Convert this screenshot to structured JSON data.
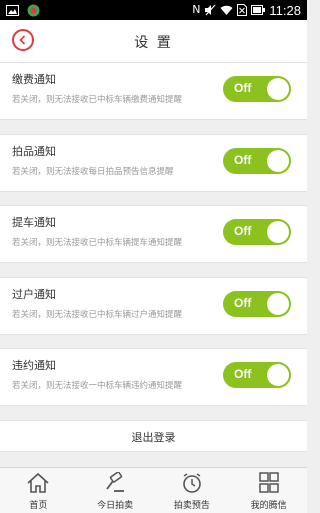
{
  "status_bar": {
    "time": "11:28",
    "icons": [
      "image-icon",
      "app-icon",
      "nfc-icon",
      "mute-icon",
      "wifi-icon",
      "no-sim-icon",
      "battery-icon"
    ]
  },
  "header": {
    "title": "设 置",
    "back_icon": "chevron-left-icon",
    "accent_color": "#e23a3a"
  },
  "settings": [
    {
      "title": "缴费通知",
      "description": "若关闭，则无法接收已中标车辆缴费通知提醒",
      "toggle": "Off"
    },
    {
      "title": "拍品通知",
      "description": "若关闭，则无法接收每日拍品预告信息提醒",
      "toggle": "Off"
    },
    {
      "title": "提车通知",
      "description": "若关闭，则无法接收已中标车辆提车通知提醒",
      "toggle": "Off"
    },
    {
      "title": "过户通知",
      "description": "若关闭，则无法接收已中标车辆过户通知提醒",
      "toggle": "Off"
    },
    {
      "title": "违约通知",
      "description": "若关闭，则无法接收一中标车辆违约通知提醒",
      "toggle": "Off"
    }
  ],
  "toggle_color": "#8bc21f",
  "logout_label": "退出登录",
  "bottom_nav": [
    {
      "label": "首页",
      "icon": "home-icon"
    },
    {
      "label": "今日拍卖",
      "icon": "gavel-icon"
    },
    {
      "label": "拍卖预告",
      "icon": "alarm-clock-icon"
    },
    {
      "label": "我的腾信",
      "icon": "grid-icon"
    }
  ]
}
